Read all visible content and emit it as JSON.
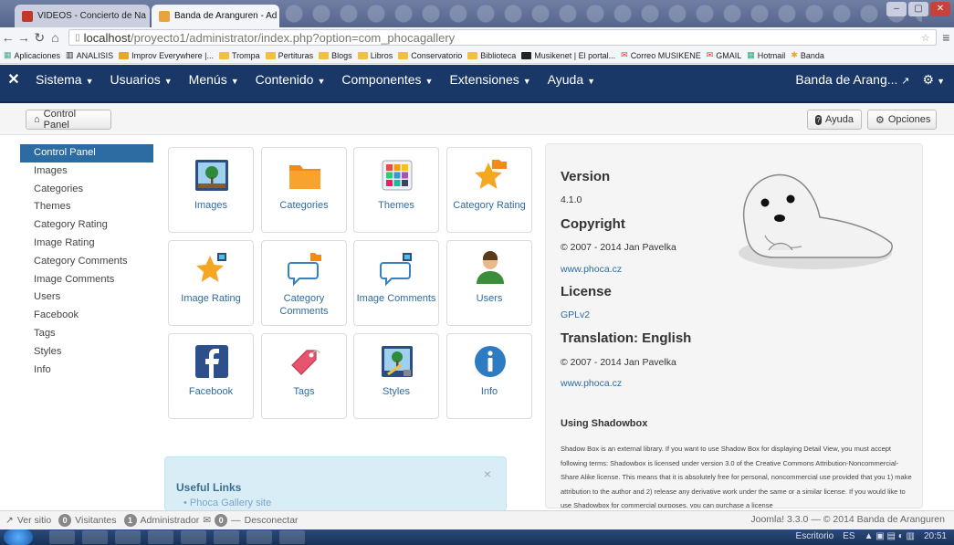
{
  "browser": {
    "tabs": [
      {
        "title": "VIDEOS - Concierto de Na",
        "close": "×"
      },
      {
        "title": "Banda de Aranguren - Ad",
        "close": "×"
      }
    ],
    "url": {
      "host": "localhost",
      "path": "/proyecto1/administrator/index.php?option=com_phocagallery"
    },
    "bookmarks": [
      "Aplicaciones",
      "ANALISIS",
      "Improv Everywhere |...",
      "Trompa",
      "Pertituras",
      "Blogs",
      "Libros",
      "Conservatorio",
      "Biblioteca",
      "Musikenet | El portal...",
      "Correo MUSIKENE",
      "GMAIL",
      "Hotmail",
      "Banda"
    ]
  },
  "menubar": {
    "items": [
      "Sistema",
      "Usuarios",
      "Menús",
      "Contenido",
      "Componentes",
      "Extensiones",
      "Ayuda"
    ],
    "site_name": "Banda de Arang..."
  },
  "toolbar": {
    "control_panel": "Control Panel",
    "help": "Ayuda",
    "options": "Opciones"
  },
  "sidebar": {
    "items": [
      "Control Panel",
      "Images",
      "Categories",
      "Themes",
      "Category Rating",
      "Image Rating",
      "Category Comments",
      "Image Comments",
      "Users",
      "Facebook",
      "Tags",
      "Styles",
      "Info"
    ]
  },
  "cards": {
    "images": "Images",
    "categories": "Categories",
    "themes": "Themes",
    "category_rating": "Category Rating",
    "image_rating": "Image Rating",
    "category_comments": "Category Comments",
    "image_comments": "Image Comments",
    "users": "Users",
    "facebook": "Facebook",
    "tags": "Tags",
    "styles": "Styles",
    "info": "Info"
  },
  "info": {
    "version_h": "Version",
    "version": "4.1.0",
    "copyright_h": "Copyright",
    "copyright": "© 2007 - 2014 Jan Pavelka",
    "copyright_link": "www.phoca.cz",
    "license_h": "License",
    "license": "GPLv2",
    "translation_h": "Translation: English",
    "translation": "© 2007 - 2014 Jan Pavelka",
    "translation_link": "www.phoca.cz",
    "shadowbox_h": "Using Shadowbox",
    "shadowbox_text": "Shadow Box is an external library. If you want to use Shadow Box for displaying Detail View, you must accept following terms: Shadowbox is licensed under version 3.0 of the Creative Commons Attribution-Noncommercial-Share Alike license. This means that it is absolutely free for personal, noncommercial use provided that you 1) make attribution to the author and 2) release any derivative work under the same or a similar license. If you would like to use Shadowbox for commercial purposes, you can purchase a license"
  },
  "useful_links": {
    "title": "Useful Links",
    "item": "Phoca Gallery site",
    "close": "×"
  },
  "status": {
    "ver_sitio": "Ver sitio",
    "visitors_count": "0",
    "visitors": "Visitantes",
    "admin_count": "1",
    "admin": "Administrador",
    "msg_count": "0",
    "disconnect": "Desconectar",
    "footer": "Joomla! 3.3.0 — © 2014 Banda de Aranguren"
  },
  "taskbar": {
    "desktop": "Escritorio",
    "lang": "ES",
    "time": "20:51"
  },
  "colors": {
    "menubar": "#1a3867",
    "link": "#2d6ca2",
    "active_item": "#2d6ca2"
  }
}
